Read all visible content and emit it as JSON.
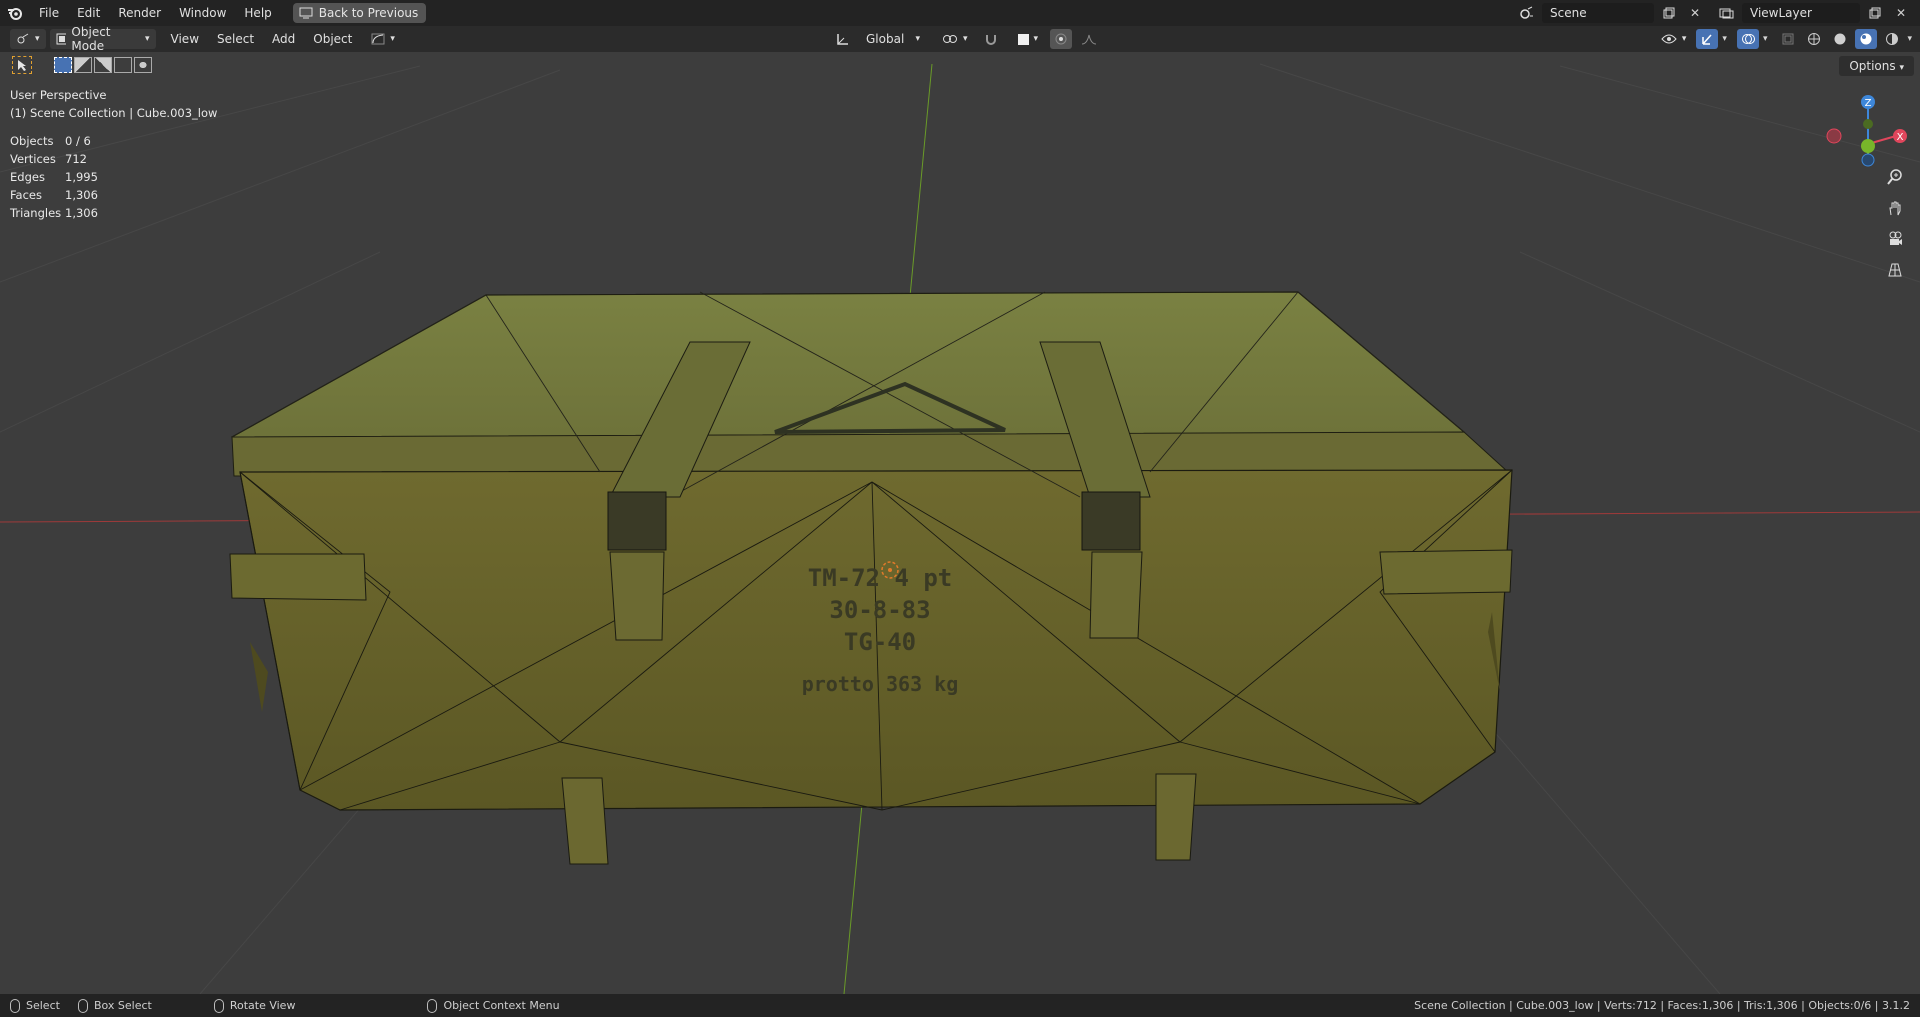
{
  "topbar": {
    "menus": [
      "File",
      "Edit",
      "Render",
      "Window",
      "Help"
    ],
    "back_label": "Back to Previous",
    "scene_name": "Scene",
    "view_layer": "ViewLayer"
  },
  "header": {
    "mode": "Object Mode",
    "menus": [
      "View",
      "Select",
      "Add",
      "Object"
    ],
    "orientation": "Global",
    "options_label": "Options"
  },
  "viewport": {
    "perspective": "User Perspective",
    "collection": "(1) Scene Collection | Cube.003_low",
    "stats": [
      {
        "label": "Objects",
        "value": "0 / 6"
      },
      {
        "label": "Vertices",
        "value": "712"
      },
      {
        "label": "Edges",
        "value": "1,995"
      },
      {
        "label": "Faces",
        "value": "1,306"
      },
      {
        "label": "Triangles",
        "value": "1,306"
      }
    ],
    "crate_text": [
      "TM-72 4 pt",
      "30-8-83",
      "TG-40",
      "protto 363 kg"
    ],
    "gizmo": {
      "x_color": "#e0465c",
      "y_color": "#78b62a",
      "z_color": "#3e87d9"
    }
  },
  "statusbar": {
    "select": "Select",
    "box_select": "Box Select",
    "rotate_view": "Rotate View",
    "context_menu": "Object Context Menu",
    "info": "Scene Collection | Cube.003_low | Verts:712 | Faces:1,306 | Tris:1,306 | Objects:0/6 | 3.1.2"
  }
}
